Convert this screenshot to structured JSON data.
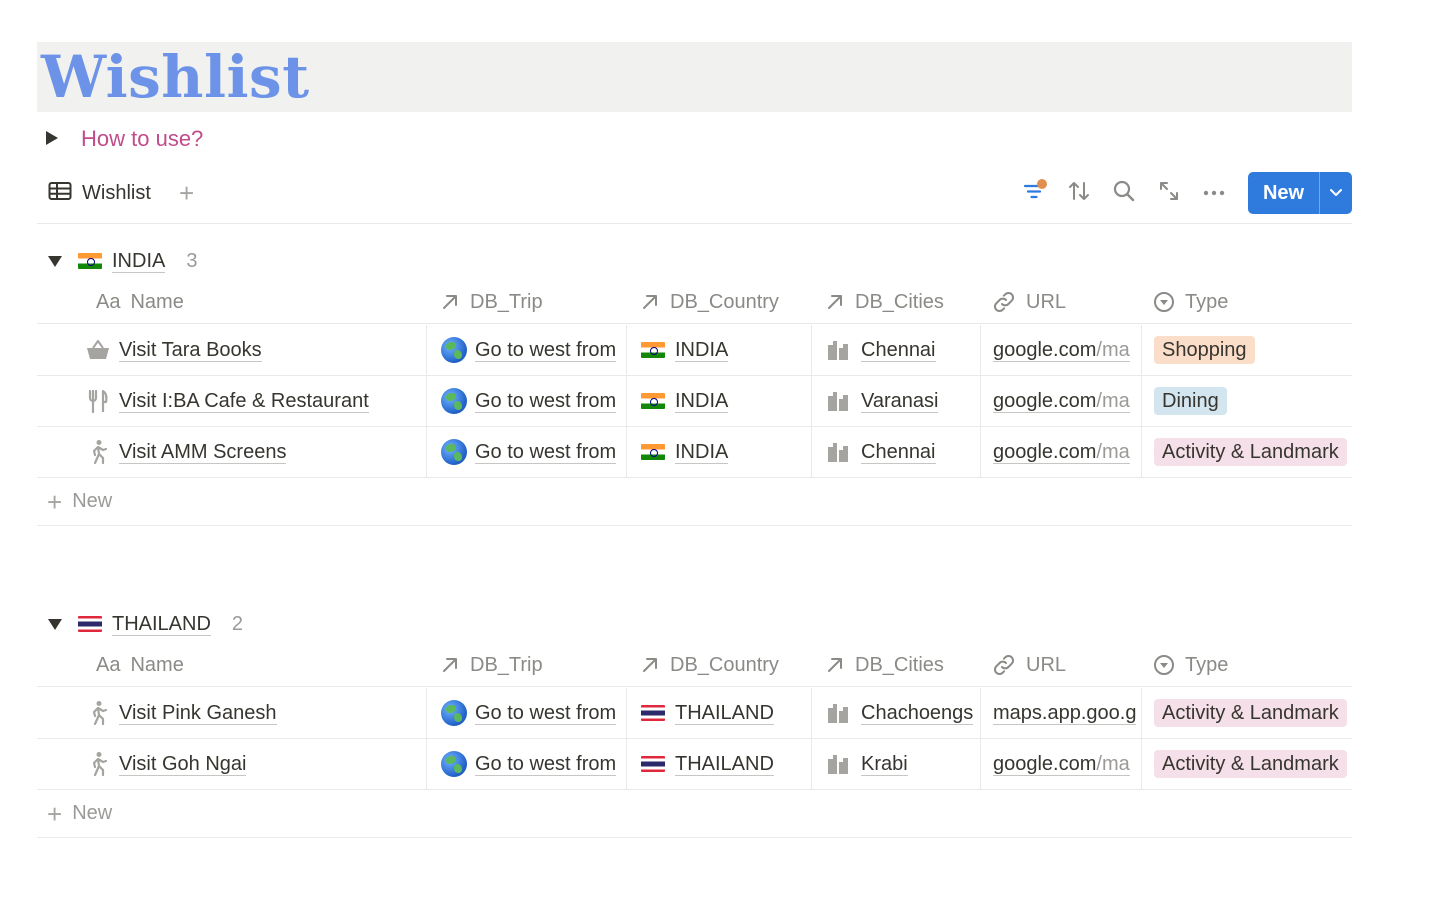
{
  "page": {
    "title": "Wishlist"
  },
  "toggle": {
    "label": "How to use?"
  },
  "view": {
    "tab_label": "Wishlist",
    "add_symbol": "+",
    "new_label": "New"
  },
  "columns": {
    "name": "Name",
    "trip": "DB_Trip",
    "country": "DB_Country",
    "cities": "DB_Cities",
    "url": "URL",
    "type": "Type",
    "name_icon_text": "Aa"
  },
  "groups": [
    {
      "name": "INDIA",
      "count": "3",
      "rows": [
        {
          "icon": "basket-icon",
          "name": "Visit Tara Books",
          "trip": "Go to west from",
          "country": "INDIA",
          "city": "Chennai",
          "url_domain": "google.com",
          "url_path": "/ma",
          "type": "Shopping",
          "type_color": "#fadec9"
        },
        {
          "icon": "fork-knife-icon",
          "name": "Visit I:BA Cafe & Restaurant",
          "trip": "Go to west from",
          "country": "INDIA",
          "city": "Varanasi",
          "url_domain": "google.com",
          "url_path": "/ma",
          "type": "Dining",
          "type_color": "#d3e5ef"
        },
        {
          "icon": "person-walking-icon",
          "name": "Visit AMM Screens",
          "trip": "Go to west from",
          "country": "INDIA",
          "city": "Chennai",
          "url_domain": "google.com",
          "url_path": "/ma",
          "type": "Activity & Landmark",
          "type_color": "#f5e0e9"
        }
      ],
      "new_label": "New"
    },
    {
      "name": "THAILAND",
      "count": "2",
      "rows": [
        {
          "icon": "person-walking-icon",
          "name": "Visit Pink Ganesh",
          "trip": "Go to west from",
          "country": "THAILAND",
          "city": "Chachoengs",
          "url_domain": "maps.app.goo.g",
          "url_path": "",
          "type": "Activity & Landmark",
          "type_color": "#f5e0e9"
        },
        {
          "icon": "person-walking-icon",
          "name": "Visit Goh Ngai",
          "trip": "Go to west from",
          "country": "THAILAND",
          "city": "Krabi",
          "url_domain": "google.com",
          "url_path": "/ma",
          "type": "Activity & Landmark",
          "type_color": "#f5e0e9"
        }
      ],
      "new_label": "New"
    }
  ],
  "colors": {
    "title": "#6c93e8",
    "toggle_label": "#c14c8a",
    "primary_button": "#2f7bdd",
    "filter_dot": "#e08f4e"
  }
}
